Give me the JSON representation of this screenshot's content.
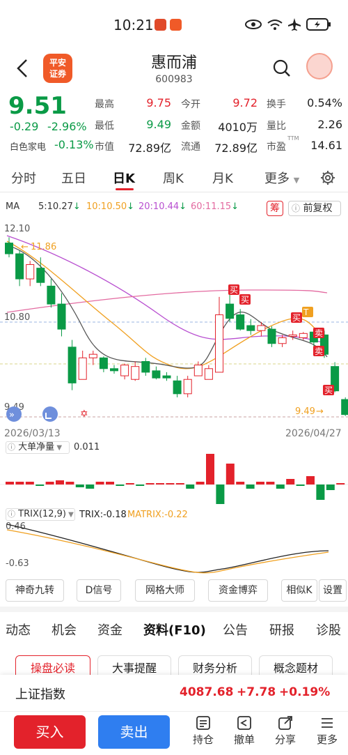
{
  "status_bar": {
    "time": "10:21",
    "app_icon_1": "Temu",
    "app_icon_2": "平安证券"
  },
  "header": {
    "logo_text": "平安\n证券",
    "stock_name": "惠而浦",
    "stock_code": "600983"
  },
  "quote": {
    "price": "9.51",
    "change": "-0.29",
    "change_pct": "-2.96%",
    "sector_label": "白色家电",
    "sector_pct": "-0.13%",
    "fields": [
      {
        "label": "最高",
        "value": "9.75",
        "color": "#e3222b"
      },
      {
        "label": "今开",
        "value": "9.72",
        "color": "#e3222b"
      },
      {
        "label": "换手",
        "value": "0.54%",
        "color": "#222"
      },
      {
        "label": "最低",
        "value": "9.49",
        "color": "#0a9a46"
      },
      {
        "label": "金额",
        "value": "4010万",
        "color": "#222"
      },
      {
        "label": "量比",
        "value": "2.26",
        "color": "#222"
      },
      {
        "label": "市值",
        "value": "72.89亿",
        "color": "#222"
      },
      {
        "label": "流通",
        "value": "72.89亿",
        "color": "#222"
      },
      {
        "label": "市盈",
        "value": "14.61",
        "color": "#222",
        "sup": "TTM"
      }
    ]
  },
  "chart_tabs": [
    "分时",
    "五日",
    "日K",
    "周K",
    "月K",
    "更多"
  ],
  "active_chart_tab": "日K",
  "ma_legend": {
    "label": "MA",
    "ma5": "5:10.27",
    "ma10": "10:10.50",
    "ma20": "20:10.44",
    "ma60": "60:11.15",
    "chip_label": "筹",
    "adjust_label": "前复权"
  },
  "kline": {
    "price_high_label": "12.10",
    "price_mid_label": "10.80",
    "price_low_label": "9.49",
    "max_annotation": "11.86",
    "min_annotation": "9.49",
    "date_start": "2026/03/13",
    "date_end": "2026/04/27",
    "buy_marker": "买",
    "sell_marker": "卖",
    "t_marker": "T"
  },
  "volume_panel": {
    "label": "大单净量",
    "value": "0.011"
  },
  "trix_panel": {
    "label": "TRIX(12,9)",
    "trix": "TRIX:-0.18",
    "matrix": "MATRIX:-0.22",
    "high_label": "0.46",
    "low_label": "-0.63"
  },
  "indicator_buttons": [
    "神奇九转",
    "D信号",
    "网格大师",
    "资金博弈",
    "相似K",
    "设置"
  ],
  "info_tabs": [
    "动态",
    "机会",
    "资金",
    "资料(F10)",
    "公告",
    "研报",
    "诊股"
  ],
  "active_info_tab": "资料(F10)",
  "info_cards": [
    "操盘必读",
    "大事提醒",
    "财务分析",
    "概念题材"
  ],
  "index_bar": {
    "name": "上证指数",
    "value": "4087.68",
    "change": "+7.78",
    "change_pct": "+0.19%"
  },
  "bottom_actions": {
    "buy": "买入",
    "sell": "卖出",
    "position": "持仓",
    "cancel": "撤单",
    "share": "分享",
    "more": "更多"
  },
  "colors": {
    "up": "#e3222b",
    "down": "#0a9a46",
    "accent_blue": "#2f7ef0",
    "ma5": "#333333",
    "ma10": "#f0a020",
    "ma20": "#b84fd0",
    "ma60": "#e36aa0"
  }
}
